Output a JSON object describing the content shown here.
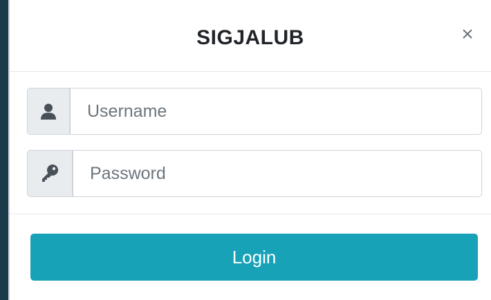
{
  "modal": {
    "title": "SIGJALUB",
    "close_label": "×"
  },
  "form": {
    "username": {
      "icon": "user-icon",
      "value": "",
      "placeholder": "Username"
    },
    "password": {
      "icon": "key-icon",
      "value": "",
      "placeholder": "Password"
    }
  },
  "footer": {
    "login_label": "Login"
  },
  "colors": {
    "primary": "#17a2b8",
    "addon_bg": "#e9ecef",
    "icon": "#495057",
    "title": "#212529"
  }
}
